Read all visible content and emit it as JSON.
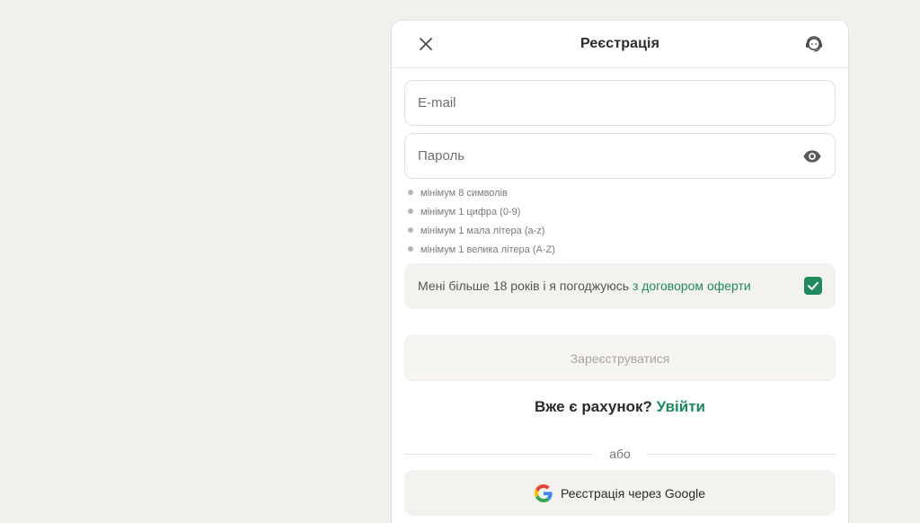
{
  "modal": {
    "title": "Реєстрація"
  },
  "icons": {
    "close": "close-icon",
    "support": "headset-icon",
    "eye": "eye-icon",
    "check": "checkmark-icon",
    "google": "google-icon"
  },
  "form": {
    "email_placeholder": "E-mail",
    "email_value": "",
    "password_placeholder": "Пароль",
    "password_value": ""
  },
  "password_rules": [
    "мінімум 8 символів",
    "мінімум 1 цифра (0-9)",
    "мінімум 1 мала літера (a-z)",
    "мінімум 1 велика літера (A-Z)"
  ],
  "agreement": {
    "text": "Мені більше 18 років і я погоджуюсь ",
    "link": "з договором оферти",
    "checked": true
  },
  "register_button": "Зареєструватися",
  "login": {
    "question": "Вже є рахунок?",
    "link": "Увійти"
  },
  "divider_text": "або",
  "google_button": "Реєстрація через Google",
  "colors": {
    "page_background": "#f2f0ec",
    "accent_green": "#1f8a5b",
    "disabled_text": "#a9a6a0"
  }
}
